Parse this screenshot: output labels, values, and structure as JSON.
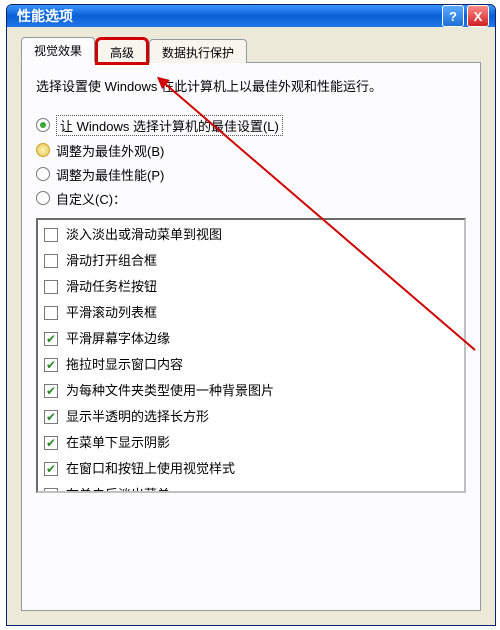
{
  "window": {
    "title": "性能选项"
  },
  "titlebar": {
    "help_icon": "?",
    "close_icon": "X"
  },
  "tabs": [
    {
      "label": "视觉效果",
      "active": true
    },
    {
      "label": "高级",
      "active": false,
      "highlight": true
    },
    {
      "label": "数据执行保护",
      "active": false
    }
  ],
  "description": "选择设置使 Windows 在此计算机上以最佳外观和性能运行。",
  "radios": [
    {
      "label": "让 Windows 选择计算机的最佳设置(L)",
      "selected": true,
      "focused": true
    },
    {
      "label": "调整为最佳外观(B)",
      "selected": false,
      "gold": true
    },
    {
      "label": "调整为最佳性能(P)",
      "selected": false
    },
    {
      "label": "自定义(C)：",
      "selected": false
    }
  ],
  "items": [
    {
      "label": "淡入淡出或滑动菜单到视图",
      "checked": false
    },
    {
      "label": "滑动打开组合框",
      "checked": false
    },
    {
      "label": "滑动任务栏按钮",
      "checked": false
    },
    {
      "label": "平滑滚动列表框",
      "checked": false
    },
    {
      "label": "平滑屏幕字体边缘",
      "checked": true
    },
    {
      "label": "拖拉时显示窗口内容",
      "checked": true
    },
    {
      "label": "为每种文件夹类型使用一种背景图片",
      "checked": true
    },
    {
      "label": "显示半透明的选择长方形",
      "checked": true
    },
    {
      "label": "在菜单下显示阴影",
      "checked": true
    },
    {
      "label": "在窗口和按钮上使用视觉样式",
      "checked": true
    },
    {
      "label": "在单击后淡出菜单",
      "checked": false
    }
  ],
  "annotation": {
    "color": "#d10000"
  }
}
